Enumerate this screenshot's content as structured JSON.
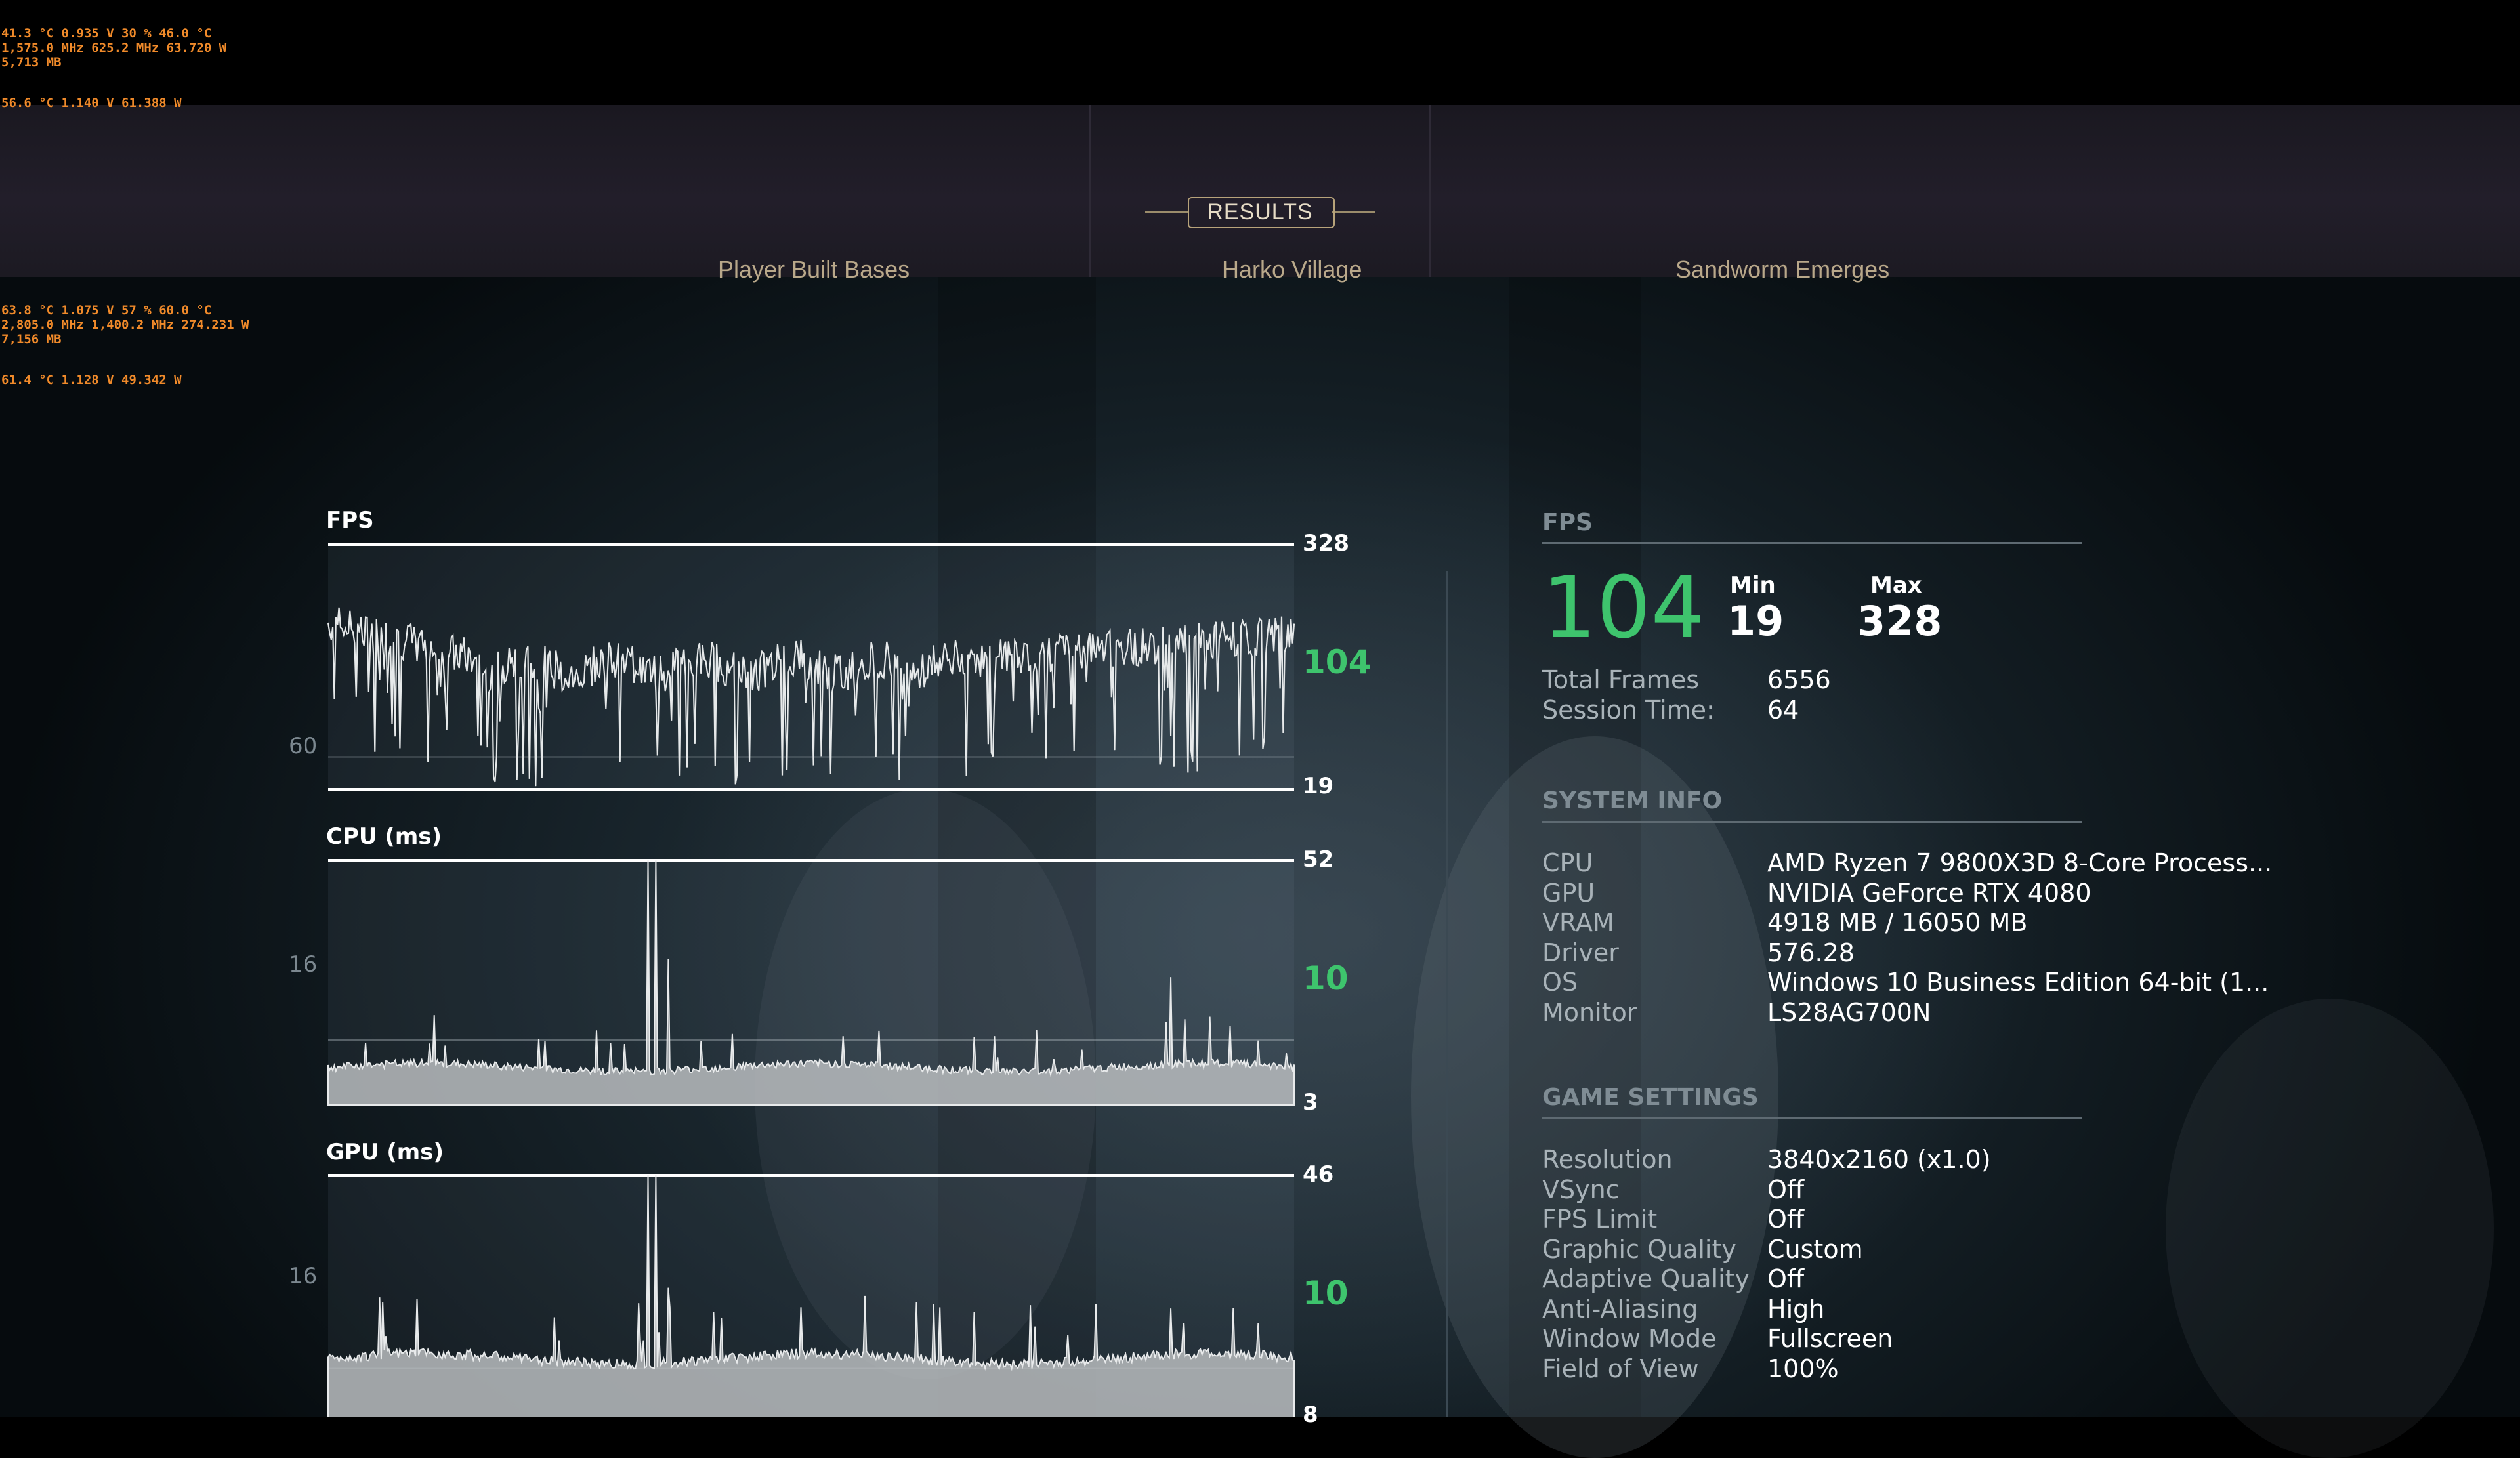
{
  "hw_overlay": {
    "block1": [
      "41.3 °C 0.935 V 30 % 46.0 °C",
      "1,575.0 MHz 625.2 MHz 63.720 W",
      "5,713 MB"
    ],
    "block1b": "56.6 °C 1.140 V 61.388 W",
    "block2": [
      "63.8 °C 1.075 V 57 % 60.0 °C",
      "2,805.0 MHz 1,400.2 MHz 274.231 W",
      "7,156 MB"
    ],
    "block2b": "61.4 °C 1.128 V 49.342 W"
  },
  "header": {
    "title": "RESULTS",
    "tabs": [
      "Player Built Bases",
      "Harko Village",
      "Sandworm Emerges"
    ]
  },
  "charts": {
    "fps": {
      "title": "FPS",
      "max": "328",
      "avg": "104",
      "min": "19",
      "ref": "60"
    },
    "cpu": {
      "title": "CPU (ms)",
      "max": "52",
      "avg": "10",
      "min": "3",
      "ref": "16"
    },
    "gpu": {
      "title": "GPU (ms)",
      "max": "46",
      "avg": "10",
      "min": "8",
      "ref": "16"
    }
  },
  "chart_data": [
    {
      "type": "line",
      "title": "FPS",
      "ylim": [
        19,
        328
      ],
      "reference_line": 60,
      "average": 104,
      "min": 19,
      "max": 328
    },
    {
      "type": "area",
      "title": "CPU (ms)",
      "ylim": [
        3,
        52
      ],
      "reference_line": 16,
      "average": 10,
      "min": 3,
      "max": 52
    },
    {
      "type": "area",
      "title": "GPU (ms)",
      "ylim": [
        8,
        46
      ],
      "reference_line": 16,
      "average": 10,
      "min": 8,
      "max": 46
    }
  ],
  "fps_panel": {
    "header": "FPS",
    "average": "104",
    "min_label": "Min",
    "min": "19",
    "max_label": "Max",
    "max": "328",
    "stats": [
      {
        "label": "Total Frames",
        "value": "6556"
      },
      {
        "label": "Session Time:",
        "value": "64"
      }
    ]
  },
  "system_info": {
    "header": "SYSTEM INFO",
    "rows": [
      {
        "label": "CPU",
        "value": "AMD Ryzen 7 9800X3D 8-Core Process..."
      },
      {
        "label": "GPU",
        "value": "NVIDIA GeForce RTX 4080"
      },
      {
        "label": "VRAM",
        "value": "4918 MB / 16050 MB"
      },
      {
        "label": "Driver",
        "value": "576.28"
      },
      {
        "label": "OS",
        "value": "Windows 10 Business Edition 64-bit (1..."
      },
      {
        "label": "Monitor",
        "value": "LS28AG700N"
      }
    ]
  },
  "game_settings": {
    "header": "GAME SETTINGS",
    "rows": [
      {
        "label": "Resolution",
        "value": "3840x2160 (x1.0)"
      },
      {
        "label": "VSync",
        "value": "Off"
      },
      {
        "label": "FPS Limit",
        "value": "Off"
      },
      {
        "label": "Graphic Quality",
        "value": "Custom"
      },
      {
        "label": "Adaptive Quality",
        "value": "Off"
      },
      {
        "label": "Anti-Aliasing",
        "value": "High"
      },
      {
        "label": "Window Mode",
        "value": "Fullscreen"
      },
      {
        "label": "Field of View",
        "value": "100%"
      }
    ]
  },
  "colors": {
    "accent_green": "#3ec46d",
    "overlay_orange": "#f08a2a",
    "results_gold": "#b7a37a"
  }
}
